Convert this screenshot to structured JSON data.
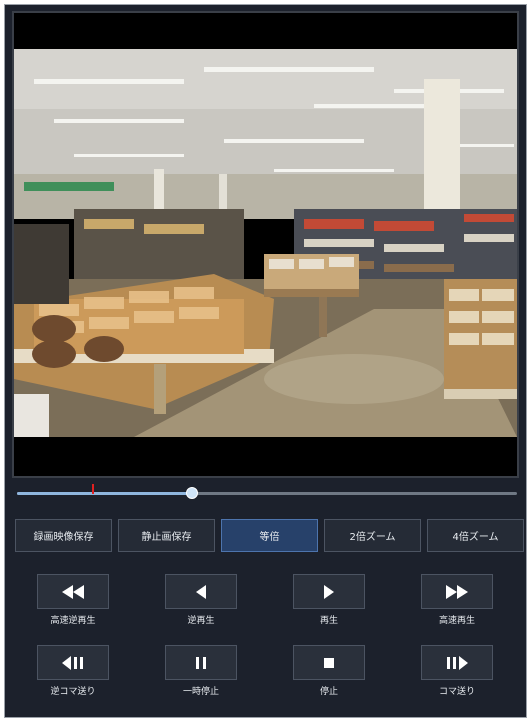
{
  "modes": [
    {
      "label": "録画映像保存",
      "active": false
    },
    {
      "label": "静止画保存",
      "active": false
    },
    {
      "label": "等倍",
      "active": true
    },
    {
      "label": "2倍ズーム",
      "active": false
    },
    {
      "label": "4倍ズーム",
      "active": false
    }
  ],
  "seek": {
    "progress": 0.35,
    "marker": 0.15
  },
  "controls": {
    "fast_rewind": "高速逆再生",
    "reverse_play": "逆再生",
    "play": "再生",
    "fast_forward": "高速再生",
    "frame_back": "逆コマ送り",
    "pause": "一時停止",
    "stop": "停止",
    "frame_forward": "コマ送り"
  },
  "colors": {
    "accent": "#27416a",
    "seek_fill": "#8fb6de",
    "marker": "#e02020"
  }
}
